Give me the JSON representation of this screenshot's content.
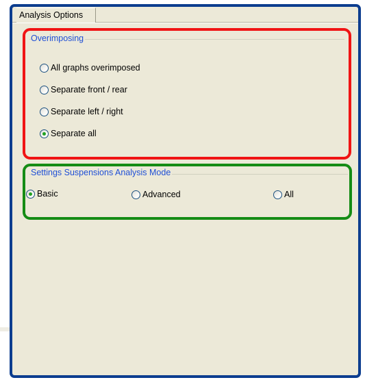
{
  "tab": {
    "label": "Analysis Options"
  },
  "overimposing": {
    "title": "Overimposing",
    "options": [
      {
        "label": "All graphs overimposed",
        "selected": false
      },
      {
        "label": "Separate front / rear",
        "selected": false
      },
      {
        "label": "Separate left / right",
        "selected": false
      },
      {
        "label": "Separate all",
        "selected": true
      }
    ]
  },
  "settings": {
    "title": "Settings Suspensions Analysis Mode",
    "options": [
      {
        "label": "Basic",
        "selected": true
      },
      {
        "label": "Advanced",
        "selected": false
      },
      {
        "label": "All",
        "selected": false
      }
    ]
  },
  "colors": {
    "window_border": "#0c3d8f",
    "panel_background": "#ece9d8",
    "group_title": "#1f4fd6",
    "highlight_red": "#f01414",
    "highlight_green": "#158c15",
    "radio_dot": "#21a121"
  },
  "icons": {
    "radio_selected": "radio-selected-icon",
    "radio_unselected": "radio-unselected-icon"
  }
}
